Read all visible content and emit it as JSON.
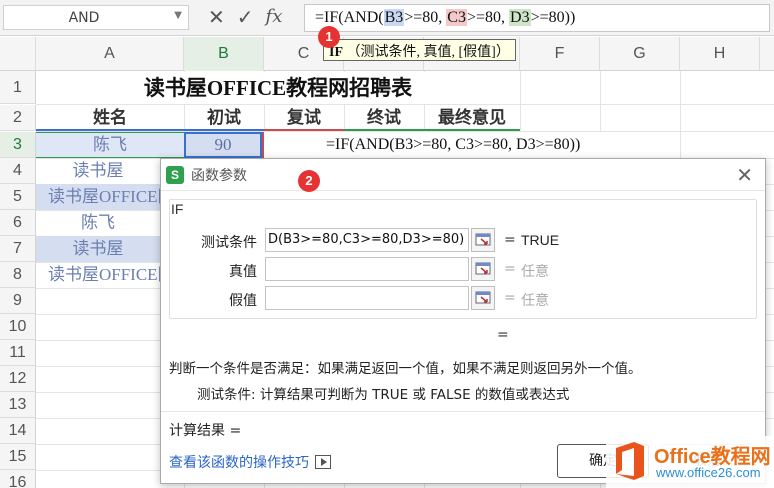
{
  "formula_bar": {
    "name_box": "AND",
    "cancel_icon": "close-icon",
    "confirm_icon": "check-icon",
    "fx_label": "fx",
    "formula_parts": [
      "=IF(AND(",
      "B3",
      ">=80, ",
      "C3",
      ">=80, ",
      "D3",
      ">=80))"
    ],
    "tooltip_fn": "IF",
    "tooltip_args": "（测试条件, 真值, [假值]）"
  },
  "badges": {
    "one": "1",
    "two": "2"
  },
  "grid": {
    "columns": [
      "A",
      "B",
      "C",
      "D",
      "E",
      "F",
      "G",
      "H"
    ],
    "rows": [
      "1",
      "2",
      "3",
      "4",
      "5",
      "6",
      "7",
      "8",
      "9",
      "10",
      "11",
      "12",
      "13",
      "14",
      "15",
      "16",
      "17"
    ],
    "active_column": "B",
    "active_row": "3",
    "title": "读书屋OFFICE教程网招聘表",
    "headers": [
      "姓名",
      "初试",
      "复试",
      "终试",
      "最终意见"
    ],
    "names": [
      "陈飞",
      "读书屋",
      "读书屋OFFICE网",
      "陈飞",
      "读书屋",
      "读书屋OFFICE网"
    ],
    "b3_value": "90",
    "c3_edit_formula": "=IF(AND(B3>=80, C3>=80, D3>=80))"
  },
  "dialog": {
    "title": "函数参数",
    "close_icon": "close-icon",
    "function_name": "IF",
    "args": [
      {
        "label": "测试条件",
        "value": "D(B3>=80,C3>=80,D3>=80)",
        "eq": "=",
        "result": "TRUE"
      },
      {
        "label": "真值",
        "value": "",
        "eq": "=",
        "result": "任意"
      },
      {
        "label": "假值",
        "value": "",
        "eq": "=",
        "result": "任意"
      }
    ],
    "result_eq": "=",
    "description": "判断一个条件是否满足：如果满足返回一个值，如果不满足则返回另外一个值。",
    "arg_description": "测试条件:  计算结果可判断为 TRUE 或 FALSE 的数值或表达式",
    "calc_result": "计算结果 =",
    "help_link": "查看该函数的操作技巧",
    "ok_label": "确定",
    "cancel_label": "取消"
  },
  "watermark": {
    "line1": "Office教程网",
    "line2": "www.office26.com"
  },
  "colors": {
    "accent_blue": "#3a6fd0",
    "green": "#2f9a49",
    "badge_red": "#e53333",
    "wm_orange": "#e8721c"
  }
}
